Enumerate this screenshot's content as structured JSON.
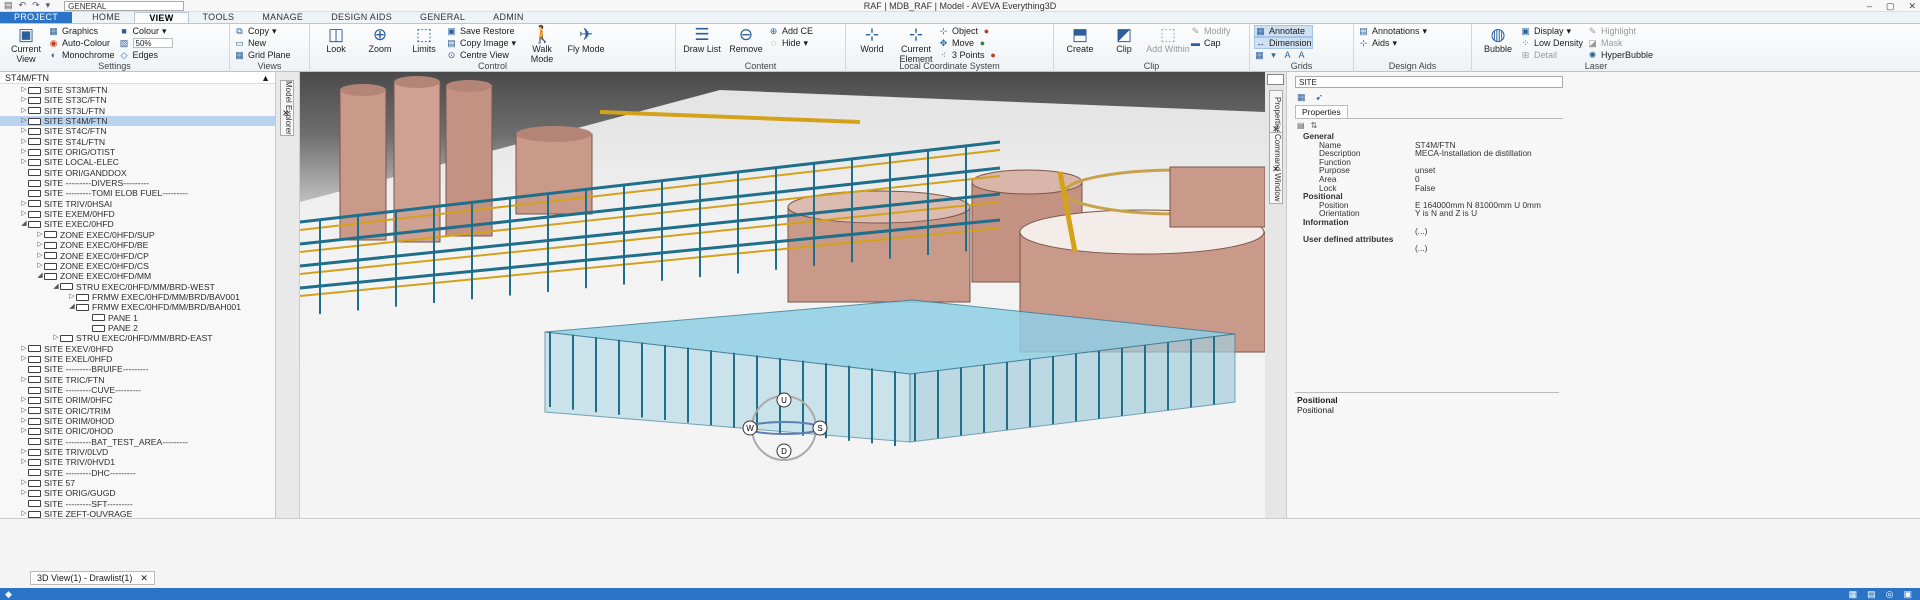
{
  "window": {
    "title": "RAF | MDB_RAF | Model - AVEVA Everything3D",
    "workspace": "GENERAL",
    "controls": [
      "–",
      "▢",
      "✕"
    ]
  },
  "tabs": [
    "PROJECT",
    "HOME",
    "VIEW",
    "TOOLS",
    "MANAGE",
    "DESIGN AIDS",
    "GENERAL",
    "ADMIN"
  ],
  "active_tab": "VIEW",
  "ribbon": {
    "settings": {
      "label": "Settings",
      "current_view": "Current View",
      "graphics": "Graphics",
      "auto_colour": "Auto-Colour",
      "monochrome": "Monochrome",
      "colour": "Colour",
      "colour_value": "50%",
      "edges": "Edges"
    },
    "views": {
      "label": "Views",
      "copy": "Copy",
      "new": "New",
      "grid_plane": "Grid Plane"
    },
    "control": {
      "label": "Control",
      "look": "Look",
      "zoom": "Zoom",
      "limits": "Limits",
      "save_restore": "Save Restore",
      "copy_image": "Copy Image",
      "centre_view": "Centre View",
      "walk_mode": "Walk Mode",
      "fly_mode": "Fly Mode"
    },
    "content": {
      "label": "Content",
      "draw_list": "Draw List",
      "remove": "Remove",
      "add_ce": "Add CE",
      "hide": "Hide"
    },
    "lcs": {
      "label": "Local Coordinate System",
      "world": "World",
      "current_element": "Current Element",
      "object": "Object",
      "move": "Move",
      "points": "3 Points"
    },
    "clip": {
      "label": "Clip",
      "create": "Create",
      "clip": "Clip",
      "add_within": "Add Within",
      "modify": "Modify",
      "cap": "Cap"
    },
    "grids": {
      "label": "Grids",
      "annotate": "Annotate",
      "dimension": "Dimension"
    },
    "design_aids": {
      "label": "Design Aids",
      "annotations": "Annotations",
      "aids": "Aids"
    },
    "laser": {
      "label": "Laser",
      "bubble": "Bubble",
      "display": "Display",
      "low_density": "Low Density",
      "detail": "Detail",
      "highlight": "Highlight",
      "mask": "Mask",
      "hyperbubble": "HyperBubble"
    }
  },
  "explorer": {
    "root": "ST4M/FTN",
    "items": [
      {
        "label": "SITE ST3M/FTN",
        "depth": 1,
        "exp": "▷"
      },
      {
        "label": "SITE ST3C/FTN",
        "depth": 1,
        "exp": "▷"
      },
      {
        "label": "SITE ST3L/FTN",
        "depth": 1,
        "exp": "▷"
      },
      {
        "label": "SITE ST4M/FTN",
        "depth": 1,
        "exp": "▷",
        "sel": true
      },
      {
        "label": "SITE ST4C/FTN",
        "depth": 1,
        "exp": "▷"
      },
      {
        "label": "SITE ST4L/FTN",
        "depth": 1,
        "exp": "▷"
      },
      {
        "label": "SITE ORIG/OTIST",
        "depth": 1,
        "exp": "▷"
      },
      {
        "label": "SITE LOCAL-ELEC",
        "depth": 1,
        "exp": "▷"
      },
      {
        "label": "SITE ORI/GANDDOX",
        "depth": 1,
        "exp": ""
      },
      {
        "label": "SITE ---------DIVERS---------",
        "depth": 1,
        "exp": ""
      },
      {
        "label": "SITE ---------TOMI ELOB FUEL---------",
        "depth": 1,
        "exp": ""
      },
      {
        "label": "SITE TRIV/0HSAI",
        "depth": 1,
        "exp": "▷"
      },
      {
        "label": "SITE EXEM/0HFD",
        "depth": 1,
        "exp": "▷"
      },
      {
        "label": "SITE EXEC/0HFD",
        "depth": 1,
        "exp": "◢"
      },
      {
        "label": "ZONE EXEC/0HFD/SUP",
        "depth": 2,
        "exp": "▷"
      },
      {
        "label": "ZONE EXEC/0HFD/BE",
        "depth": 2,
        "exp": "▷"
      },
      {
        "label": "ZONE EXEC/0HFD/CP",
        "depth": 2,
        "exp": "▷"
      },
      {
        "label": "ZONE EXEC/0HFD/CS",
        "depth": 2,
        "exp": "▷"
      },
      {
        "label": "ZONE EXEC/0HFD/MM",
        "depth": 2,
        "exp": "◢"
      },
      {
        "label": "STRU EXEC/0HFD/MM/BRD-WEST",
        "depth": 3,
        "exp": "◢"
      },
      {
        "label": "FRMW EXEC/0HFD/MM/BRD/BAV001",
        "depth": 4,
        "exp": "▷"
      },
      {
        "label": "FRMW EXEC/0HFD/MM/BRD/BAH001",
        "depth": 4,
        "exp": "◢"
      },
      {
        "label": "PANE 1",
        "depth": 5,
        "exp": ""
      },
      {
        "label": "PANE 2",
        "depth": 5,
        "exp": ""
      },
      {
        "label": "STRU EXEC/0HFD/MM/BRD-EAST",
        "depth": 3,
        "exp": "▷"
      },
      {
        "label": "SITE EXEV/0HFD",
        "depth": 1,
        "exp": "▷"
      },
      {
        "label": "SITE EXEL/0HFD",
        "depth": 1,
        "exp": "▷"
      },
      {
        "label": "SITE ---------BRUIFE---------",
        "depth": 1,
        "exp": ""
      },
      {
        "label": "SITE TRIC/FTN",
        "depth": 1,
        "exp": "▷"
      },
      {
        "label": "SITE ---------CUVE---------",
        "depth": 1,
        "exp": ""
      },
      {
        "label": "SITE ORIM/0HFC",
        "depth": 1,
        "exp": "▷"
      },
      {
        "label": "SITE ORIC/TRIM",
        "depth": 1,
        "exp": "▷"
      },
      {
        "label": "SITE ORIM/0HOD",
        "depth": 1,
        "exp": "▷"
      },
      {
        "label": "SITE ORIC/0HOD",
        "depth": 1,
        "exp": "▷"
      },
      {
        "label": "SITE ---------BAT_TEST_AREA---------",
        "depth": 1,
        "exp": ""
      },
      {
        "label": "SITE TRIV/0LVD",
        "depth": 1,
        "exp": "▷"
      },
      {
        "label": "SITE TRIV/0HVD1",
        "depth": 1,
        "exp": "▷"
      },
      {
        "label": "SITE ---------DHC---------",
        "depth": 1,
        "exp": ""
      },
      {
        "label": "SITE 57",
        "depth": 1,
        "exp": "▷"
      },
      {
        "label": "SITE ORIG/GUGD",
        "depth": 1,
        "exp": "▷"
      },
      {
        "label": "SITE ---------SFT---------",
        "depth": 1,
        "exp": ""
      },
      {
        "label": "SITE ZEFT-OUVRAGE",
        "depth": 1,
        "exp": "▷"
      }
    ]
  },
  "side_tabs": {
    "left": "Model Explorer",
    "right_a": "Properties",
    "right_b": "Command Window"
  },
  "properties": {
    "combo": "SITE",
    "tab": "Properties",
    "groups": [
      {
        "name": "General",
        "rows": [
          [
            "Name",
            "ST4M/FTN"
          ],
          [
            "Description",
            "MECA-Installation de distillation"
          ],
          [
            "Function",
            ""
          ],
          [
            "Purpose",
            "unset"
          ],
          [
            "Area",
            "0"
          ],
          [
            "Lock",
            "False"
          ]
        ]
      },
      {
        "name": "Positional",
        "rows": [
          [
            "Position",
            "E 164000mm N 81000mm U 0mm"
          ],
          [
            "Orientation",
            "Y is N and Z is U"
          ]
        ]
      },
      {
        "name": "Information",
        "rows": [
          [
            "",
            "(...)"
          ]
        ]
      },
      {
        "name": "User defined attributes",
        "rows": [
          [
            "",
            "(...)"
          ]
        ]
      }
    ],
    "desc_title": "Positional",
    "desc_text": "Positional"
  },
  "navcube": {
    "u": "U",
    "w": "W",
    "s": "S",
    "d": "D"
  },
  "drawlist_tab": "3D View(1) - Drawlist(1)",
  "colors": {
    "accent": "#2a73c6",
    "steel": "#1f6f8b",
    "pipe": "#d4a21a",
    "tank": "#c9998a",
    "building": "#8fd0e6"
  }
}
